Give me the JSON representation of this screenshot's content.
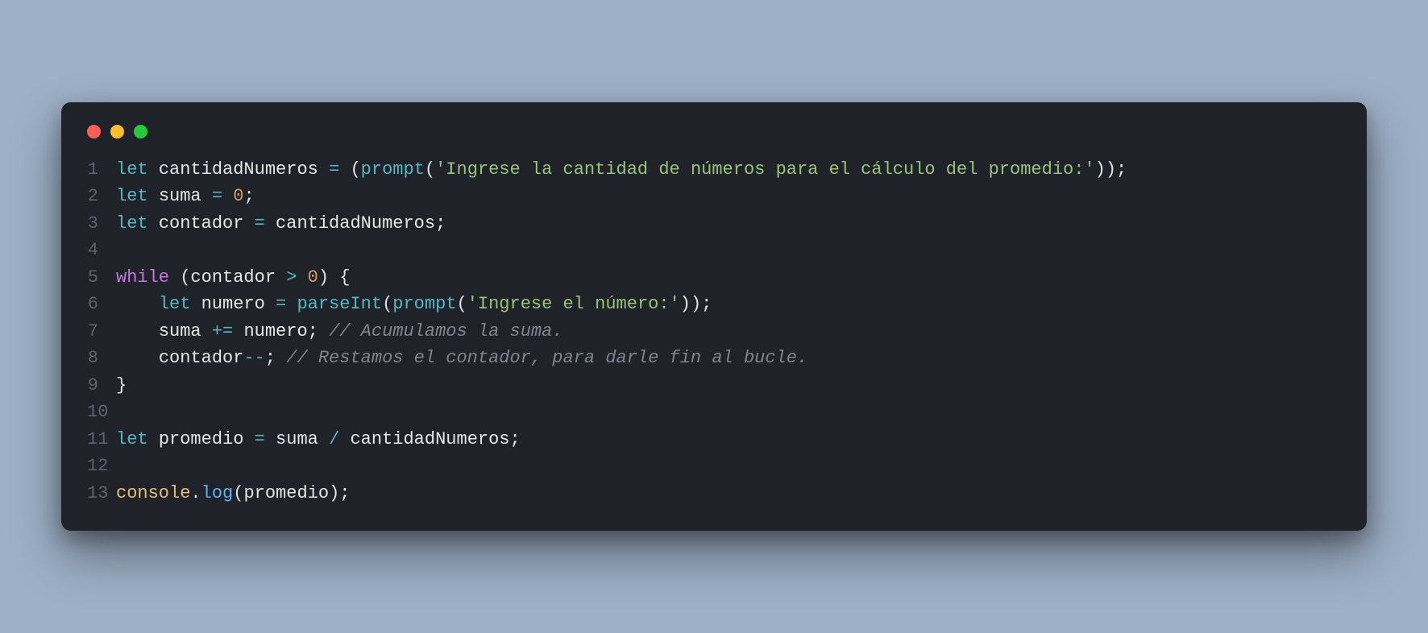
{
  "code": {
    "language": "javascript",
    "lines": [
      {
        "n": "1",
        "tokens": [
          {
            "cls": "tok-declare",
            "t": "let"
          },
          {
            "cls": "tok-plain",
            "t": " "
          },
          {
            "cls": "tok-ident",
            "t": "cantidadNumeros"
          },
          {
            "cls": "tok-plain",
            "t": " "
          },
          {
            "cls": "tok-op",
            "t": "="
          },
          {
            "cls": "tok-plain",
            "t": " "
          },
          {
            "cls": "tok-punct",
            "t": "("
          },
          {
            "cls": "tok-func",
            "t": "prompt"
          },
          {
            "cls": "tok-punct",
            "t": "("
          },
          {
            "cls": "tok-string",
            "t": "'Ingrese la cantidad de números para el cálculo del promedio:'"
          },
          {
            "cls": "tok-punct",
            "t": "));"
          }
        ]
      },
      {
        "n": "2",
        "tokens": [
          {
            "cls": "tok-declare",
            "t": "let"
          },
          {
            "cls": "tok-plain",
            "t": " "
          },
          {
            "cls": "tok-ident",
            "t": "suma"
          },
          {
            "cls": "tok-plain",
            "t": " "
          },
          {
            "cls": "tok-op",
            "t": "="
          },
          {
            "cls": "tok-plain",
            "t": " "
          },
          {
            "cls": "tok-number",
            "t": "0"
          },
          {
            "cls": "tok-punct",
            "t": ";"
          }
        ]
      },
      {
        "n": "3",
        "tokens": [
          {
            "cls": "tok-declare",
            "t": "let"
          },
          {
            "cls": "tok-plain",
            "t": " "
          },
          {
            "cls": "tok-ident",
            "t": "contador"
          },
          {
            "cls": "tok-plain",
            "t": " "
          },
          {
            "cls": "tok-op",
            "t": "="
          },
          {
            "cls": "tok-plain",
            "t": " "
          },
          {
            "cls": "tok-ident",
            "t": "cantidadNumeros"
          },
          {
            "cls": "tok-punct",
            "t": ";"
          }
        ]
      },
      {
        "n": "4",
        "tokens": []
      },
      {
        "n": "5",
        "tokens": [
          {
            "cls": "tok-keyword",
            "t": "while"
          },
          {
            "cls": "tok-plain",
            "t": " "
          },
          {
            "cls": "tok-punct",
            "t": "("
          },
          {
            "cls": "tok-ident",
            "t": "contador"
          },
          {
            "cls": "tok-plain",
            "t": " "
          },
          {
            "cls": "tok-op",
            "t": ">"
          },
          {
            "cls": "tok-plain",
            "t": " "
          },
          {
            "cls": "tok-number",
            "t": "0"
          },
          {
            "cls": "tok-punct",
            "t": ") {"
          }
        ]
      },
      {
        "n": "6",
        "tokens": [
          {
            "cls": "tok-plain",
            "t": "    "
          },
          {
            "cls": "tok-declare",
            "t": "let"
          },
          {
            "cls": "tok-plain",
            "t": " "
          },
          {
            "cls": "tok-ident",
            "t": "numero"
          },
          {
            "cls": "tok-plain",
            "t": " "
          },
          {
            "cls": "tok-op",
            "t": "="
          },
          {
            "cls": "tok-plain",
            "t": " "
          },
          {
            "cls": "tok-func",
            "t": "parseInt"
          },
          {
            "cls": "tok-punct",
            "t": "("
          },
          {
            "cls": "tok-func",
            "t": "prompt"
          },
          {
            "cls": "tok-punct",
            "t": "("
          },
          {
            "cls": "tok-string",
            "t": "'Ingrese el número:'"
          },
          {
            "cls": "tok-punct",
            "t": "));"
          }
        ]
      },
      {
        "n": "7",
        "tokens": [
          {
            "cls": "tok-plain",
            "t": "    "
          },
          {
            "cls": "tok-ident",
            "t": "suma"
          },
          {
            "cls": "tok-plain",
            "t": " "
          },
          {
            "cls": "tok-op",
            "t": "+="
          },
          {
            "cls": "tok-plain",
            "t": " "
          },
          {
            "cls": "tok-ident",
            "t": "numero"
          },
          {
            "cls": "tok-punct",
            "t": "; "
          },
          {
            "cls": "tok-comment",
            "t": "// Acumulamos la suma."
          }
        ]
      },
      {
        "n": "8",
        "tokens": [
          {
            "cls": "tok-plain",
            "t": "    "
          },
          {
            "cls": "tok-ident",
            "t": "contador"
          },
          {
            "cls": "tok-op",
            "t": "--"
          },
          {
            "cls": "tok-punct",
            "t": "; "
          },
          {
            "cls": "tok-comment",
            "t": "// Restamos el contador, para darle fin al bucle."
          }
        ]
      },
      {
        "n": "9",
        "tokens": [
          {
            "cls": "tok-punct",
            "t": "}"
          }
        ]
      },
      {
        "n": "10",
        "tokens": []
      },
      {
        "n": "11",
        "tokens": [
          {
            "cls": "tok-declare",
            "t": "let"
          },
          {
            "cls": "tok-plain",
            "t": " "
          },
          {
            "cls": "tok-ident",
            "t": "promedio"
          },
          {
            "cls": "tok-plain",
            "t": " "
          },
          {
            "cls": "tok-op",
            "t": "="
          },
          {
            "cls": "tok-plain",
            "t": " "
          },
          {
            "cls": "tok-ident",
            "t": "suma"
          },
          {
            "cls": "tok-plain",
            "t": " "
          },
          {
            "cls": "tok-op",
            "t": "/"
          },
          {
            "cls": "tok-plain",
            "t": " "
          },
          {
            "cls": "tok-ident",
            "t": "cantidadNumeros"
          },
          {
            "cls": "tok-punct",
            "t": ";"
          }
        ]
      },
      {
        "n": "12",
        "tokens": []
      },
      {
        "n": "13",
        "tokens": [
          {
            "cls": "tok-const",
            "t": "console"
          },
          {
            "cls": "tok-punct",
            "t": "."
          },
          {
            "cls": "tok-method",
            "t": "log"
          },
          {
            "cls": "tok-punct",
            "t": "("
          },
          {
            "cls": "tok-ident",
            "t": "promedio"
          },
          {
            "cls": "tok-punct",
            "t": ");"
          }
        ]
      }
    ]
  }
}
